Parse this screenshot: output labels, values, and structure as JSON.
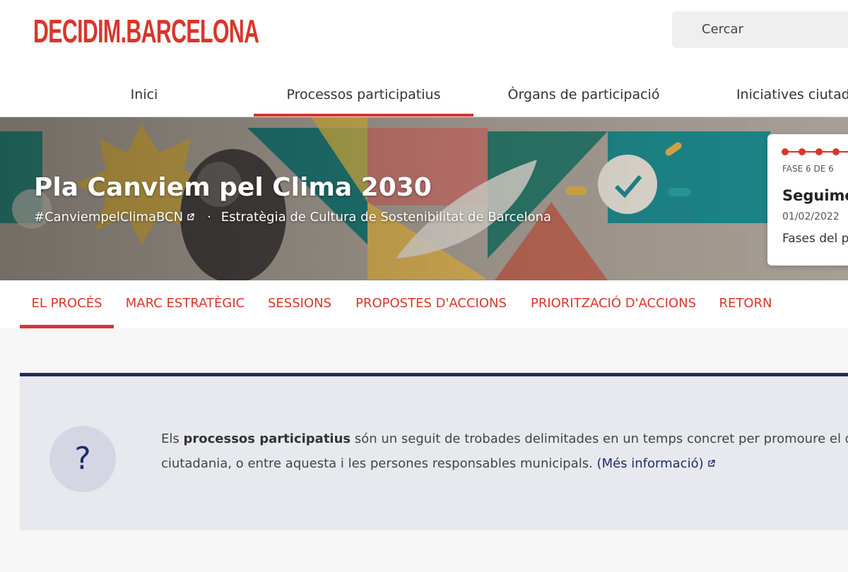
{
  "header": {
    "logo": "DECIDIM.BARCELONA",
    "search_placeholder": "Cercar"
  },
  "nav": {
    "items": [
      {
        "label": "Inici",
        "active": false
      },
      {
        "label": "Processos participatius",
        "active": true
      },
      {
        "label": "Òrgans de participació",
        "active": false
      },
      {
        "label": "Iniciatives ciutadanes",
        "active": false
      }
    ]
  },
  "hero": {
    "title": "Pla Canviem pel Clima 2030",
    "hashtag": "#CanviempelClimaBCN",
    "separator": "·",
    "subtitle": "Estratègia de Cultura de Sostenibilitat de Barcelona"
  },
  "phase": {
    "label": "FASE 6 DE 6",
    "name": "Seguiment",
    "date": "01/02/2022",
    "link": "Fases del procés",
    "total_phases": 6,
    "current_phase": 6
  },
  "subnav": {
    "items": [
      {
        "label": "EL PROCÉS",
        "active": true
      },
      {
        "label": "MARC ESTRATÈGIC",
        "active": false
      },
      {
        "label": "SESSIONS",
        "active": false
      },
      {
        "label": "PROPOSTES D'ACCIONS",
        "active": false
      },
      {
        "label": "PRIORITZACIÓ D'ACCIONS",
        "active": false
      },
      {
        "label": "RETORN",
        "active": false
      }
    ]
  },
  "info": {
    "icon_symbol": "?",
    "text_before": "Els ",
    "bold": "processos participatius",
    "text_line1_rest": " són un seguit de trobades delimitades en un temps concret per promoure el debat",
    "text_line2": "ciutadania, o entre aquesta i les persones responsables municipals. ",
    "link": "(Més informació)"
  },
  "colors": {
    "brand_red": "#d8362b",
    "navy": "#1f2c6b",
    "info_bg": "#e8e9ee",
    "page_bg": "#f7f7f7"
  },
  "icons": {
    "external_link": "external-link-icon",
    "question": "question-icon"
  }
}
